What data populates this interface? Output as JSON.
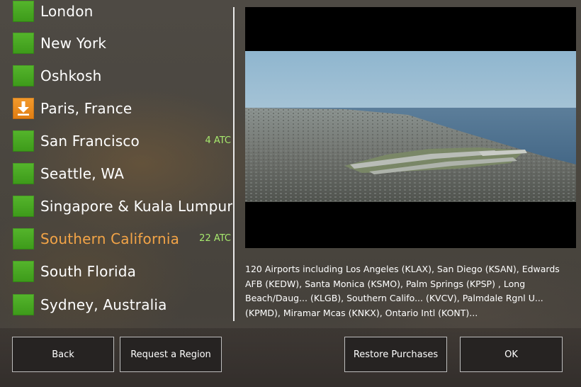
{
  "regions": [
    {
      "name": "London",
      "atc": "",
      "icon": "green-square-icon",
      "highlight": false
    },
    {
      "name": "New York",
      "atc": "",
      "icon": "green-square-icon",
      "highlight": false
    },
    {
      "name": "Oshkosh",
      "atc": "",
      "icon": "green-square-icon",
      "highlight": false
    },
    {
      "name": "Paris, France",
      "atc": "",
      "icon": "download-icon",
      "highlight": false
    },
    {
      "name": "San Francisco",
      "atc": "4 ATC",
      "icon": "green-square-icon",
      "highlight": false
    },
    {
      "name": "Seattle, WA",
      "atc": "",
      "icon": "green-square-icon",
      "highlight": false
    },
    {
      "name": "Singapore & Kuala Lumpur",
      "atc": "",
      "icon": "green-square-icon",
      "highlight": false
    },
    {
      "name": "Southern California",
      "atc": "22 ATC",
      "icon": "green-square-icon",
      "highlight": true
    },
    {
      "name": "South Florida",
      "atc": "",
      "icon": "green-square-icon",
      "highlight": false
    },
    {
      "name": "Sydney, Australia",
      "atc": "",
      "icon": "green-square-icon",
      "highlight": false
    }
  ],
  "description": "120 Airports including Los Angeles (KLAX), San Diego (KSAN), Edwards AFB (KEDW), Santa Monica (KSMO), Palm Springs (KPSP) , Long Beach/Daug... (KLGB), Southern Califo... (KVCV), Palmdale Rgnl U... (KPMD), Miramar Mcas (KNKX), Ontario Intl (KONT)...",
  "buttons": {
    "back": "Back",
    "request": "Request a Region",
    "restore": "Restore Purchases",
    "ok": "OK"
  },
  "colors": {
    "highlight": "#f3a447",
    "atc": "#a6e86d",
    "owned": "#47a822",
    "download": "#e98618"
  }
}
